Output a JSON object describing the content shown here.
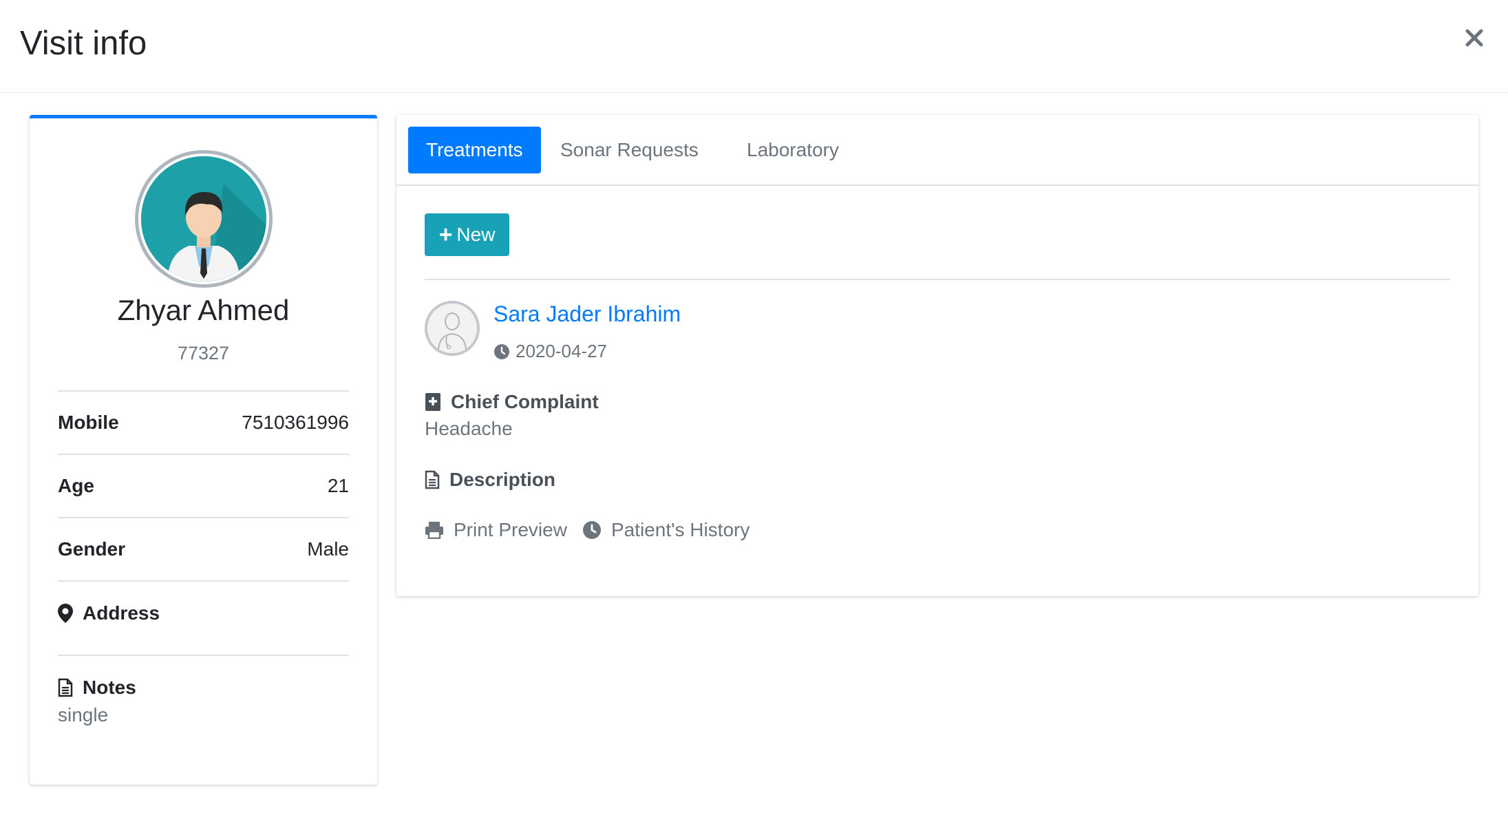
{
  "modal": {
    "title": "Visit info",
    "close_icon": "close-icon"
  },
  "patient": {
    "name": "Zhyar Ahmed",
    "id": "77327",
    "avatar_icon": "patient-avatar",
    "fields": [
      {
        "label": "Mobile",
        "value": "7510361996"
      },
      {
        "label": "Age",
        "value": "21"
      },
      {
        "label": "Gender",
        "value": "Male"
      }
    ],
    "address_label": "Address",
    "address_value": "",
    "notes_label": "Notes",
    "notes_value": "single"
  },
  "tabs": [
    {
      "label": "Treatments",
      "active": true
    },
    {
      "label": "Sonar Requests",
      "active": false
    },
    {
      "label": "Laboratory",
      "active": false
    }
  ],
  "toolbar": {
    "new_label": "New"
  },
  "treatment": {
    "doctor_name": "Sara Jader Ibrahim",
    "date": "2020-04-27",
    "chief_complaint_label": "Chief Complaint",
    "chief_complaint_value": "Headache",
    "description_label": "Description",
    "print_label": "Print Preview",
    "history_label": "Patient's History"
  },
  "colors": {
    "primary": "#007bff",
    "info": "#17a2b8",
    "muted": "#6c757d"
  }
}
